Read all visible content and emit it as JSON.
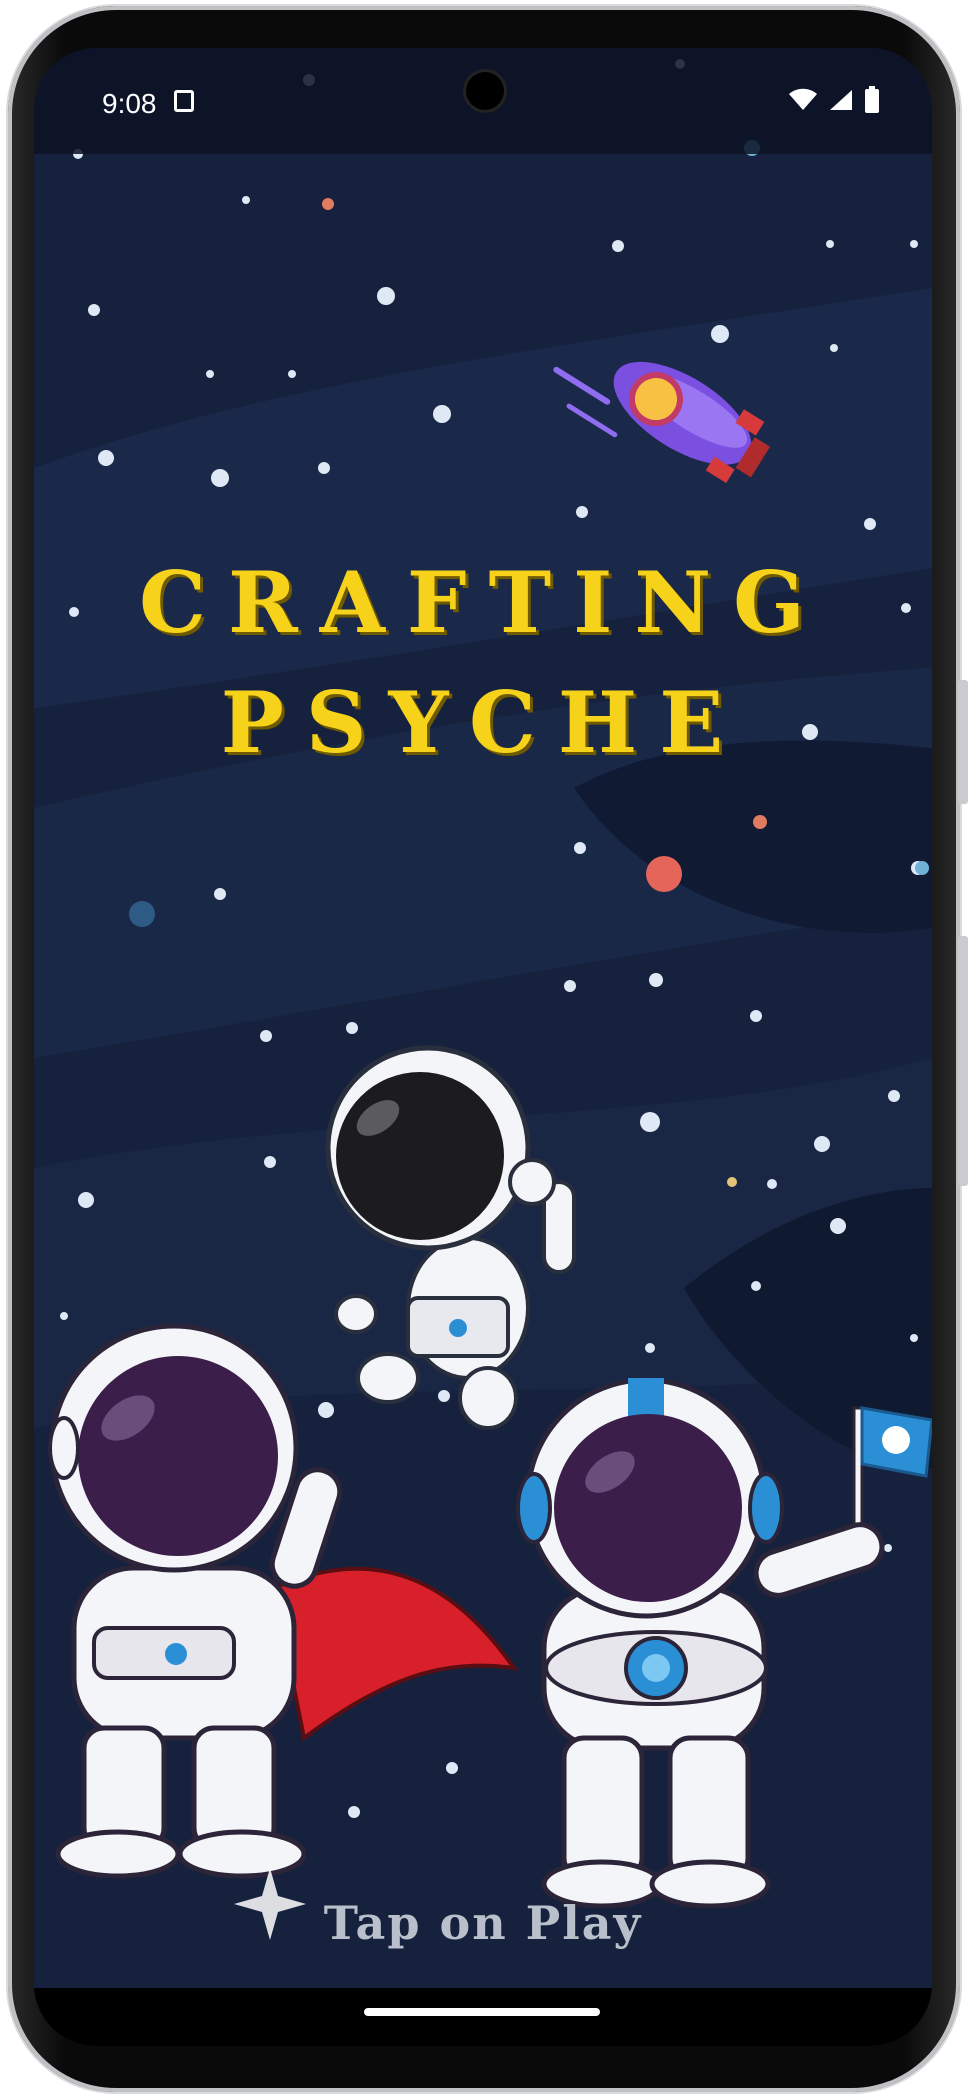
{
  "status_bar": {
    "time": "9:08"
  },
  "app": {
    "title_line1": "CRAFTING",
    "title_line2": "PSYCHE",
    "tap_hint": "Tap on Play"
  },
  "colors": {
    "background": "#16223d",
    "title": "#f6d31a",
    "hint": "#b9c0cb"
  },
  "icons": [
    "wifi-icon",
    "signal-icon",
    "battery-icon",
    "sim-card-icon",
    "rocket-icon",
    "astronaut-icon",
    "flag-icon"
  ]
}
